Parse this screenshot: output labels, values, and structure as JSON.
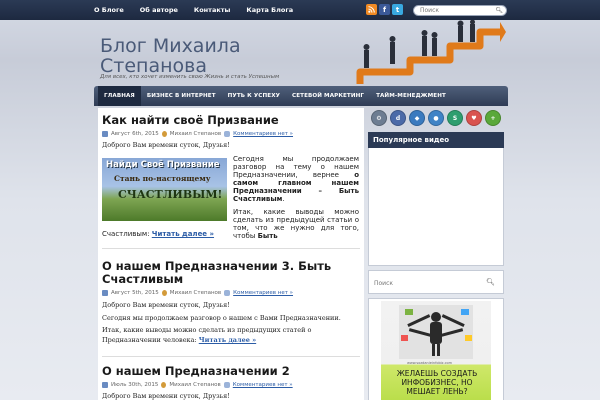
{
  "topnav": {
    "items": [
      {
        "label": "О Блоге"
      },
      {
        "label": "Об авторе"
      },
      {
        "label": "Контакты"
      },
      {
        "label": "Карта Блога"
      }
    ]
  },
  "social": {
    "icons": [
      "rss-icon",
      "facebook-icon",
      "twitter-icon"
    ]
  },
  "top_search": {
    "placeholder": "Поиск"
  },
  "header": {
    "title": "Блог Михаила Степанова",
    "description": "Для всех, кто хочет изменить свою Жизнь и стать Успешным"
  },
  "mainnav": {
    "items": [
      {
        "label": "ГЛАВНАЯ"
      },
      {
        "label": "БИЗНЕС В ИНТЕРНЕТ"
      },
      {
        "label": "ПУТЬ К УСПЕХУ"
      },
      {
        "label": "СЕТЕВОЙ МАРКЕТИНГ"
      },
      {
        "label": "ТАЙМ-МЕНЕДЖМЕНТ"
      }
    ]
  },
  "posts": [
    {
      "title": "Как найти своё Призвание",
      "date": "Август 6th, 2015",
      "author": "Михаил Степанов",
      "comments": "Комментариев нет »",
      "greeting": "Доброго Вам времени суток, Друзья!",
      "image_text": {
        "line1": "Найди Своё Призвание",
        "line2": "Стань по-настоящему",
        "line3": "СЧАСТЛИВЫМ!"
      },
      "text_a": "Сегодня мы продолжаем разговор на тему о нашем Предназначении, вернее ",
      "text_b": "о самом главном нашем Предназначении – Быть Счастливым",
      "text_c": "Итак, какие выводы можно сделать из предыдущей статьи о том, что же нужно для того, чтобы ",
      "text_d": "Быть",
      "text_e": "Счастливым",
      "readmore": "Читать далее »"
    },
    {
      "title": "О нашем Предназначении 3. Быть Счастливым",
      "date": "Август 5th, 2015",
      "author": "Михаил Степанов",
      "comments": "Комментариев нет »",
      "greeting": "Доброго Вам времени суток, Друзья!",
      "text_a": "Сегодня мы продолжаем разговор о нашем с Вами Предназначении.",
      "text_b": "Итак, какие выводы можно сделать из предыдущих статей о Предназначении человека:",
      "readmore": "Читать далее »"
    },
    {
      "title": "О нашем Предназначении 2",
      "date": "Июль 30th, 2015",
      "author": "Михаил Степанов",
      "comments": "Комментариев нет »",
      "greeting": "Доброго Вам времени суток, Друзья!"
    }
  ],
  "sidebar": {
    "share_icons": [
      {
        "name": "share-gear-icon",
        "color": "#6d7d92"
      },
      {
        "name": "share-delicious-icon",
        "color": "#4b6aa8"
      },
      {
        "name": "share-digg-icon",
        "color": "#3a7abf"
      },
      {
        "name": "share-reddit-icon",
        "color": "#3f83c6"
      },
      {
        "name": "share-stumbleupon-icon",
        "color": "#2e9e6f"
      },
      {
        "name": "share-heart-icon",
        "color": "#d9534f"
      },
      {
        "name": "share-plus-icon",
        "color": "#5aa83a"
      }
    ],
    "video_title": "Популярное видео",
    "search_placeholder": "Поиск",
    "ad": {
      "url": "www.sozdanieinfobiz.com",
      "text": "ЖЕЛАЕШЬ СОЗДАТЬ ИНФОБИЗНЕС, НО МЕШАЕТ ЛЕНЬ?"
    }
  }
}
